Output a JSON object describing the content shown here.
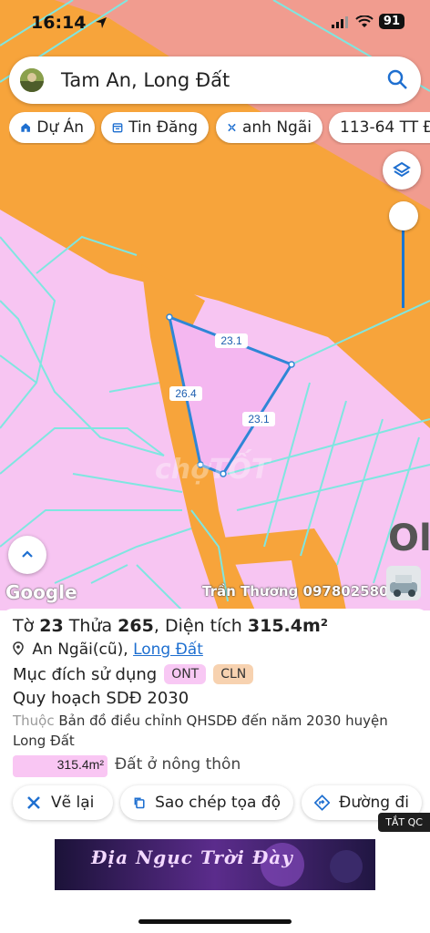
{
  "status_bar": {
    "time": "16:14",
    "battery": "91"
  },
  "search": {
    "text": "Tam An, Long Đất"
  },
  "chips": [
    {
      "label": "Dự Án",
      "icon": "house-icon"
    },
    {
      "label": "Tin Đăng",
      "icon": "calendar-icon"
    },
    {
      "label": "anh Ngãi",
      "icon": "cross-icon"
    },
    {
      "label": "113-64 TT Đ",
      "icon": ""
    }
  ],
  "map": {
    "edge_labels": {
      "top": "23.1",
      "left": "26.4",
      "right": "23.1"
    },
    "corner_letter": "Ol",
    "google_logo": "Google",
    "watermark_name": "Trần Thương 0978025802",
    "colors": {
      "residential_pink": "#f7c5f2",
      "road_orange": "#f7a43b",
      "salmon": "#f19c8f",
      "parcel_line": "#7fe6e0",
      "plot_border": "#2f86d6"
    }
  },
  "parcel": {
    "title_prefix": "Tờ",
    "sheet_no": "23",
    "plot_label": "Thửa",
    "plot_no": "265",
    "area_label": "Diện tích",
    "area": "315.4m²",
    "location_prefix": "An Ngãi(cũ),",
    "location_link": "Long Đất",
    "purpose_label": "Mục đích sử dụng",
    "tags": [
      "ONT",
      "CLN"
    ],
    "plan_title": "Quy hoạch SDĐ 2030",
    "plan_desc_prefix": "Thuộc",
    "plan_desc": "Bản đồ điều chỉnh QHSDĐ đến năm 2030 huyện Long Đất",
    "area_bar_value": "315.4m²",
    "area_bar_label": "Đất ở nông thôn"
  },
  "actions": [
    {
      "label": "Vẽ lại",
      "icon": "redraw-icon"
    },
    {
      "label": "Sao chép tọa độ",
      "icon": "copy-icon"
    },
    {
      "label": "Đường đi",
      "icon": "directions-icon"
    }
  ],
  "ad": {
    "close_label": "TẮT QC",
    "banner_text": "Địa Ngục Trời Đày"
  }
}
